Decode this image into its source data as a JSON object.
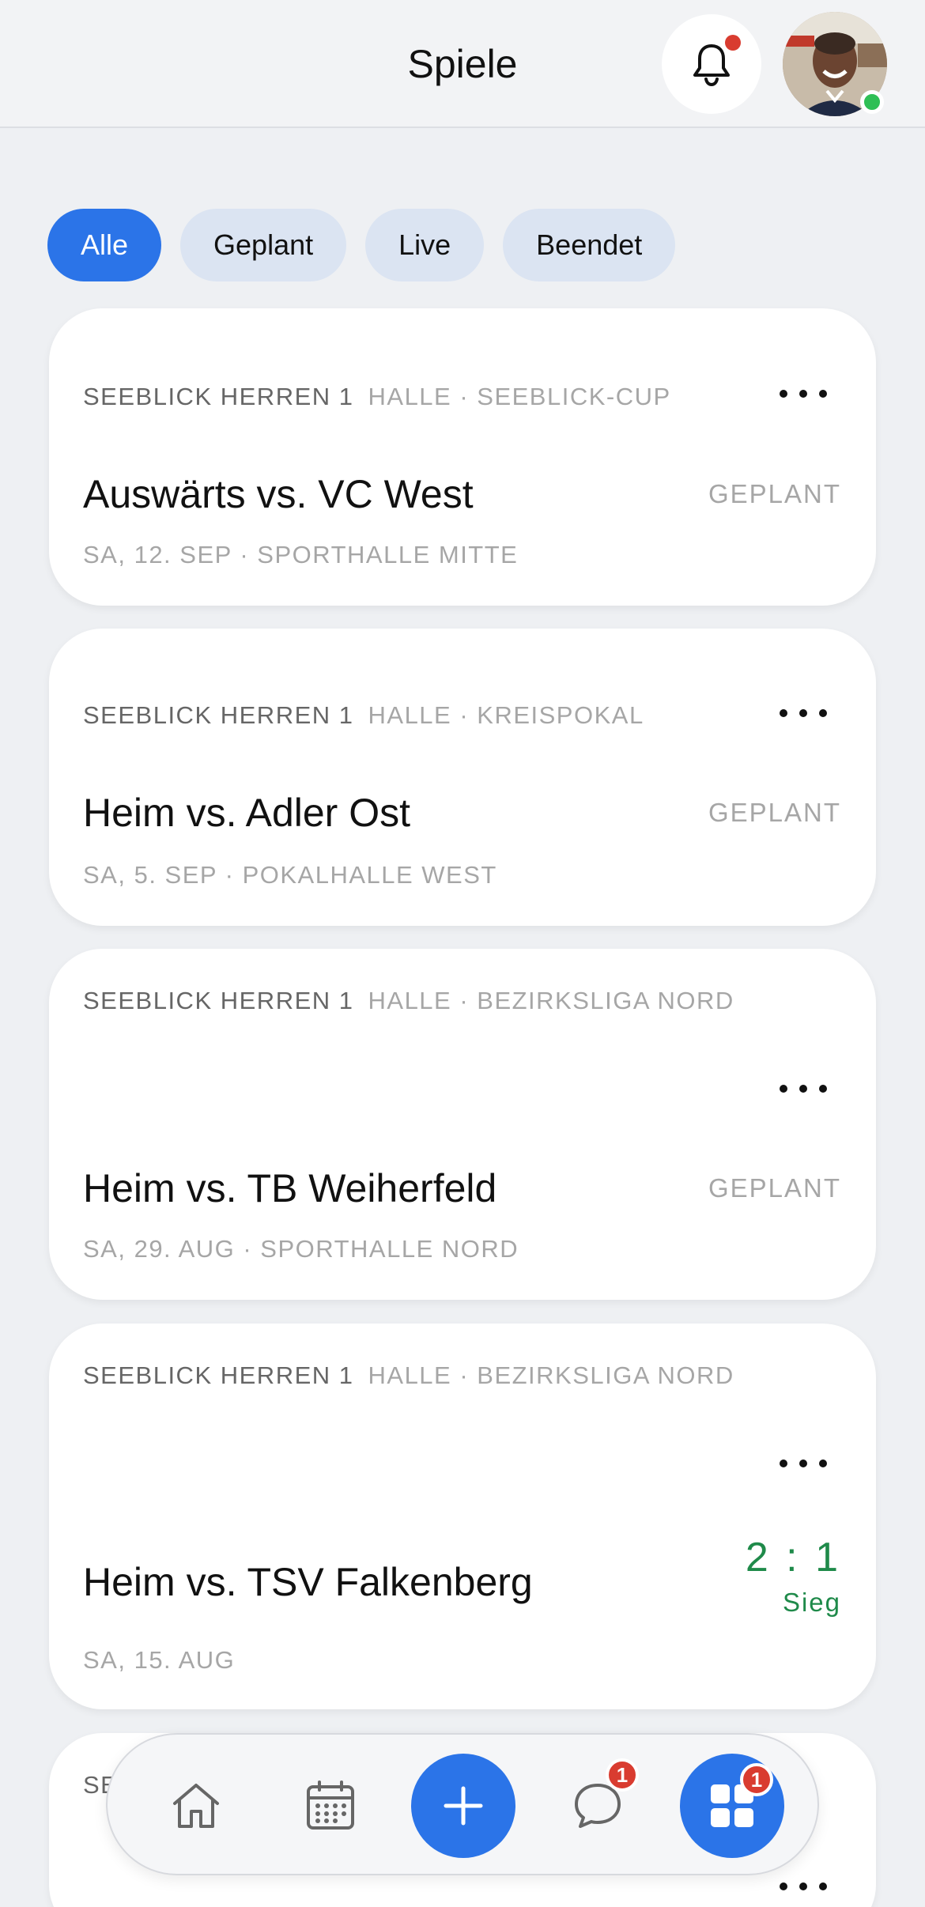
{
  "header": {
    "title": "Spiele",
    "notifications_icon": "bell-icon",
    "avatar": "user-avatar"
  },
  "filters": [
    {
      "label": "Alle",
      "active": true
    },
    {
      "label": "Geplant",
      "active": false
    },
    {
      "label": "Live",
      "active": false
    },
    {
      "label": "Beendet",
      "active": false
    }
  ],
  "games": [
    {
      "team": "Seeblick Herren 1",
      "league": "Halle · Seeblick-Cup",
      "title": "Auswärts vs. VC West",
      "status": "Geplant",
      "date_place": "Sa, 12. Sep · Sporthalle Mitte"
    },
    {
      "team": "Seeblick Herren 1",
      "league": "Halle · Kreispokal",
      "title": "Heim vs. Adler Ost",
      "status": "Geplant",
      "date_place": "Sa, 5. Sep · Pokalhalle West"
    },
    {
      "team": "Seeblick Herren 1",
      "league": "Halle · Bezirksliga Nord",
      "title": "Heim vs. TB Weiherfeld",
      "status": "Geplant",
      "date_place": "Sa, 29. Aug · Sporthalle Nord"
    },
    {
      "team": "Seeblick Herren 1",
      "league": "Halle · Bezirksliga Nord",
      "title": "Heim vs. TSV Falkenberg",
      "score": "2 : 1",
      "result": "Sieg",
      "date_place": "Sa, 15. Aug"
    },
    {
      "team": "Se"
    }
  ],
  "bottom_nav": {
    "items": [
      "home-icon",
      "calendar-icon",
      "plus-icon",
      "chat-icon",
      "grid-icon"
    ],
    "chat_badge": "1",
    "grid_badge": "1"
  },
  "colors": {
    "accent": "#2b74e8",
    "win": "#1f8a4a",
    "badge": "#d93c30",
    "online": "#2fbf55"
  }
}
